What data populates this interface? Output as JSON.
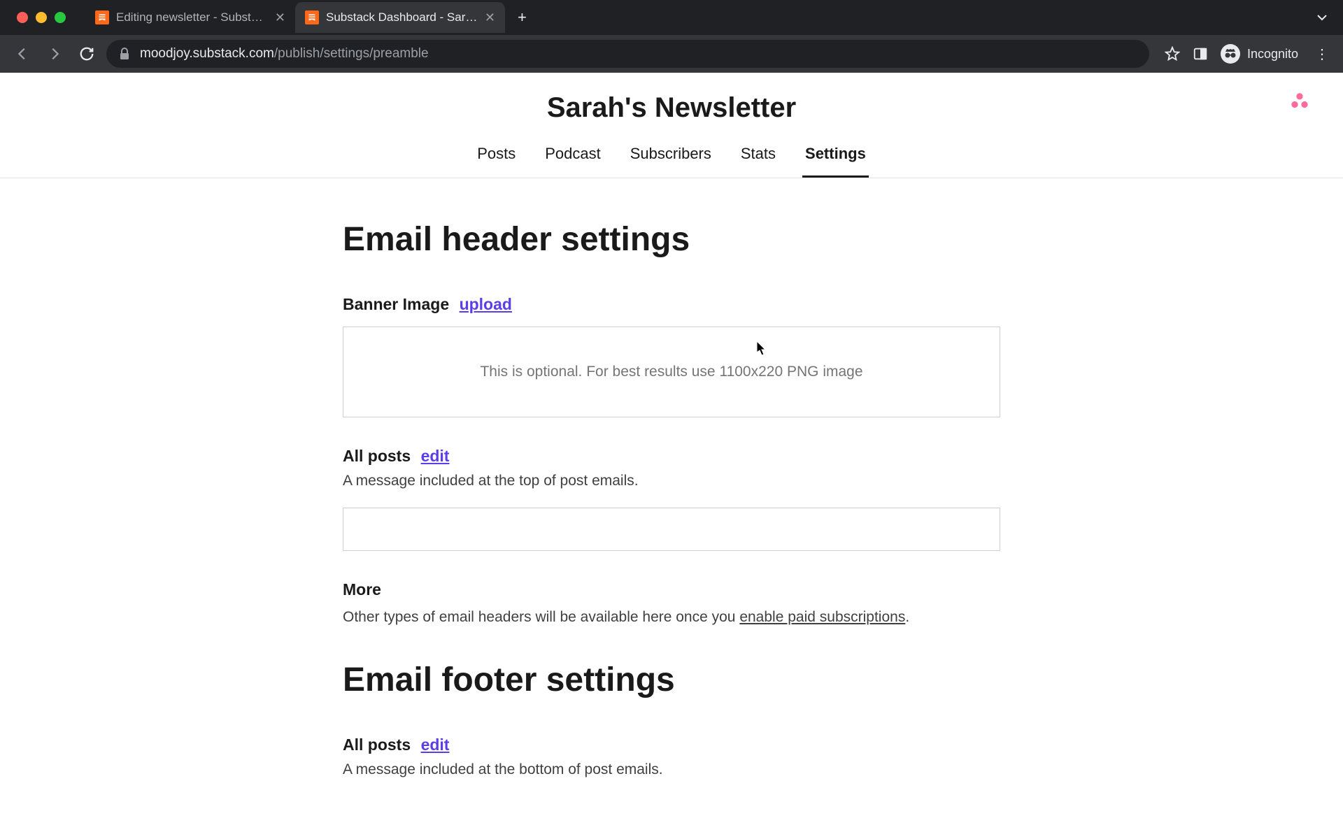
{
  "browser": {
    "tabs": [
      {
        "title": "Editing newsletter - Substack",
        "active": false
      },
      {
        "title": "Substack Dashboard - Sarah's",
        "active": true
      }
    ],
    "url_domain": "moodjoy.substack.com",
    "url_path": "/publish/settings/preamble",
    "incognito_label": "Incognito"
  },
  "header": {
    "site_title": "Sarah's Newsletter"
  },
  "nav": {
    "items": [
      "Posts",
      "Podcast",
      "Subscribers",
      "Stats",
      "Settings"
    ],
    "active_index": 4
  },
  "content": {
    "section1_title": "Email header settings",
    "banner": {
      "label": "Banner Image",
      "action": "upload",
      "placeholder": "This is optional. For best results use 1100x220 PNG image"
    },
    "all_posts_header": {
      "label": "All posts",
      "action": "edit",
      "description": "A message included at the top of post emails."
    },
    "more": {
      "label": "More",
      "text_before": "Other types of email headers will be available here once you ",
      "link_text": "enable paid subscriptions",
      "text_after": "."
    },
    "section2_title": "Email footer settings",
    "all_posts_footer": {
      "label": "All posts",
      "action": "edit",
      "description": "A message included at the bottom of post emails."
    }
  }
}
